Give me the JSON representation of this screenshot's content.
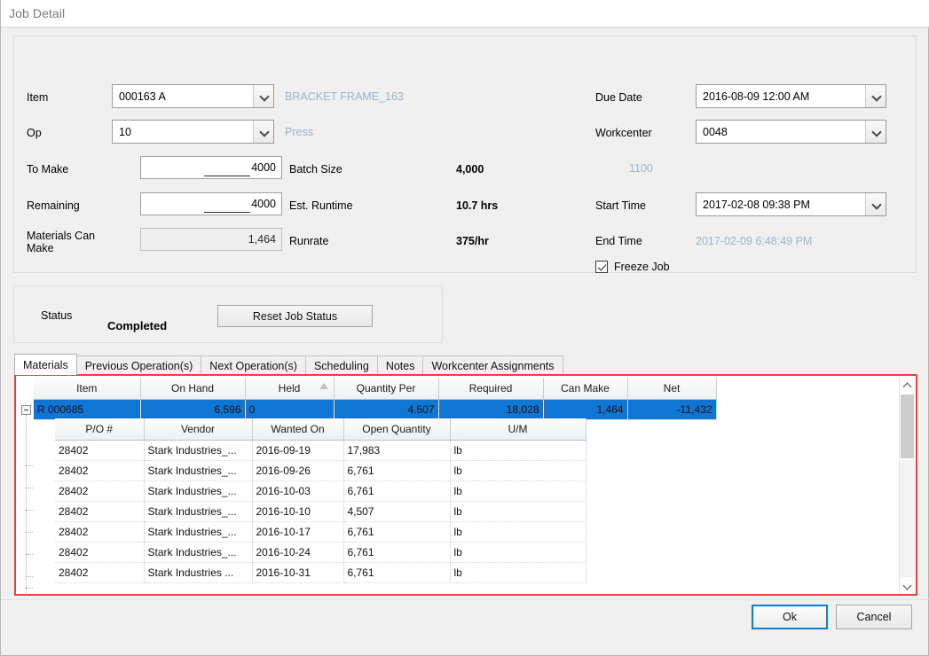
{
  "window": {
    "title": "Job Detail"
  },
  "form": {
    "item": {
      "label": "Item",
      "value": "000163 A",
      "description": "BRACKET FRAME_163"
    },
    "op": {
      "label": "Op",
      "value": "10",
      "description": "Press"
    },
    "to_make": {
      "label": "To Make",
      "value": "4000"
    },
    "remaining": {
      "label": "Remaining",
      "value": "4000"
    },
    "materials_can_make": {
      "label": "Materials Can\nMake",
      "value": "1,464"
    },
    "batch_size": {
      "label": "Batch Size",
      "value": "4,000"
    },
    "est_runtime": {
      "label": "Est. Runtime",
      "value": "10.7 hrs"
    },
    "runrate": {
      "label": "Runrate",
      "value": "375/hr"
    },
    "due_date": {
      "label": "Due Date",
      "value": "2016-08-09 12:00 AM"
    },
    "workcenter": {
      "label": "Workcenter",
      "value": "0048",
      "description": "1100"
    },
    "start_time": {
      "label": "Start Time",
      "value": "2017-02-08 09:38 PM"
    },
    "end_time": {
      "label": "End Time",
      "value": "2017-02-09 6:48:49 PM"
    },
    "freeze_job": {
      "label": "Freeze Job",
      "checked": true
    }
  },
  "status_panel": {
    "label": "Status",
    "value": "Completed",
    "reset_button": "Reset Job Status"
  },
  "tabs": [
    {
      "label": "Materials",
      "active": true
    },
    {
      "label": "Previous Operation(s)",
      "active": false
    },
    {
      "label": "Next Operation(s)",
      "active": false
    },
    {
      "label": "Scheduling",
      "active": false
    },
    {
      "label": "Notes",
      "active": false
    },
    {
      "label": "Workcenter Assignments",
      "active": false
    }
  ],
  "materials_grid": {
    "columns": [
      "Item",
      "On Hand",
      "Held",
      "Quantity Per",
      "Required",
      "Can Make",
      "Net"
    ],
    "sorted_column": "Held",
    "rows": [
      {
        "expanded": true,
        "selected": true,
        "item": "R 000685",
        "on_hand": "6,596",
        "held": "0",
        "quantity_per": "4.507",
        "required": "18,028",
        "can_make": "1,464",
        "net": "-11,432"
      }
    ]
  },
  "po_subgrid": {
    "columns": [
      "P/O #",
      "Vendor",
      "Wanted On",
      "Open Quantity",
      "U/M"
    ],
    "rows": [
      {
        "po": "28402",
        "vendor": "Stark Industries_...",
        "wanted_on": "2016-09-19",
        "open_quantity": "17,983",
        "um": "lb"
      },
      {
        "po": "28402",
        "vendor": "Stark Industries_...",
        "wanted_on": "2016-09-26",
        "open_quantity": "6,761",
        "um": "lb"
      },
      {
        "po": "28402",
        "vendor": "Stark Industries_...",
        "wanted_on": "2016-10-03",
        "open_quantity": "6,761",
        "um": "lb"
      },
      {
        "po": "28402",
        "vendor": "Stark Industries_...",
        "wanted_on": "2016-10-10",
        "open_quantity": "4,507",
        "um": "lb"
      },
      {
        "po": "28402",
        "vendor": "Stark Industries_...",
        "wanted_on": "2016-10-17",
        "open_quantity": "6,761",
        "um": "lb"
      },
      {
        "po": "28402",
        "vendor": "Stark Industries_...",
        "wanted_on": "2016-10-24",
        "open_quantity": "6,761",
        "um": "lb"
      },
      {
        "po": "28402",
        "vendor": "Stark Industries ...",
        "wanted_on": "2016-10-31",
        "open_quantity": "6,761",
        "um": "lb"
      }
    ]
  },
  "footer": {
    "ok": "Ok",
    "cancel": "Cancel"
  },
  "colors": {
    "selection": "#1076d4",
    "highlight_border": "#f4403c",
    "focus_border": "#0f7fd4",
    "muted_text": "#9bb3cc"
  }
}
